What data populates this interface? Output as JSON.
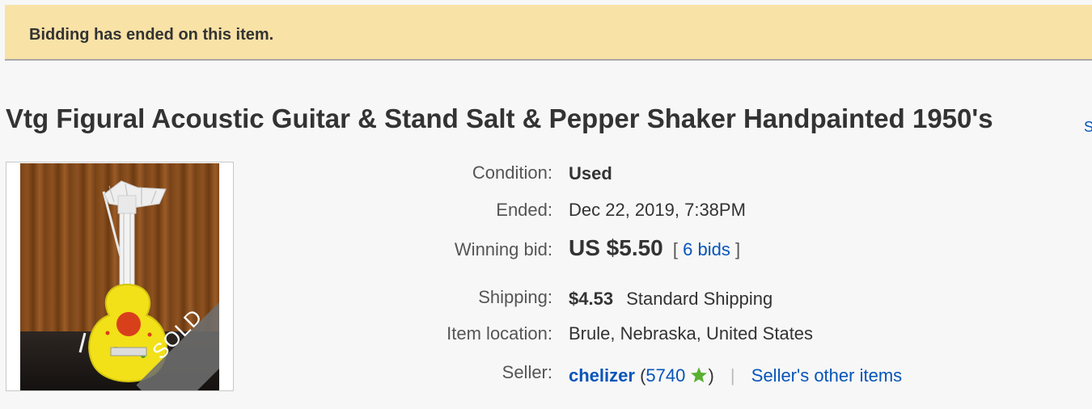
{
  "notice": {
    "text": "Bidding has ended on this item."
  },
  "item": {
    "title": "Vtg Figural Acoustic Guitar & Stand Salt & Pepper Shaker Handpainted 1950's",
    "title_overflow": "S"
  },
  "photo": {
    "badge": "SOLD"
  },
  "details": {
    "condition_label": "Condition:",
    "condition_value": "Used",
    "ended_label": "Ended:",
    "ended_date": "Dec 22, 2019",
    "ended_time": ", 7:38PM",
    "bid_label": "Winning bid:",
    "bid_amount": "US $5.50",
    "bid_open": "[",
    "bid_count": "6 bids",
    "bid_close": "]",
    "shipping_label": "Shipping:",
    "shipping_cost": "$4.53",
    "shipping_method": "Standard Shipping",
    "location_label": "Item location:",
    "location_value": "Brule, Nebraska, United States",
    "seller_label": "Seller:",
    "seller_name": "chelizer",
    "seller_feedback_open": "(",
    "seller_feedback": "5740",
    "seller_feedback_close": ")",
    "seller_separator": "|",
    "seller_other_items": "Seller's other items"
  },
  "colors": {
    "notice_bg": "#f9e2a6",
    "link": "#0654ba",
    "feedback_star": "#58b031"
  },
  "icons": {
    "feedback_star": "star-icon"
  }
}
